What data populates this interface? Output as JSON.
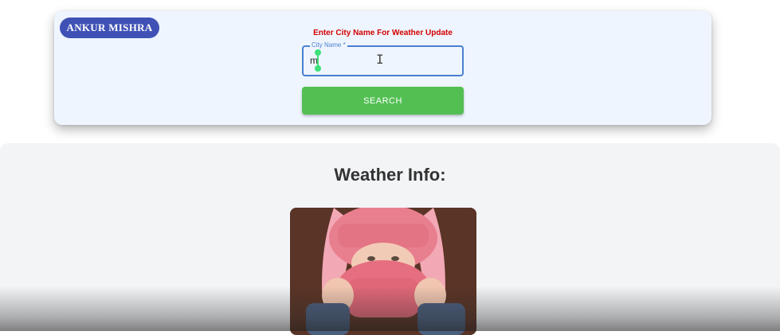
{
  "brand": {
    "name": "ANKUR MISHRA"
  },
  "search_form": {
    "prompt": "Enter City Name For Weather Update",
    "city_field_label": "City Name *",
    "city_field_value": "m",
    "search_button_label": "SEARCH"
  },
  "weather_section": {
    "title": "Weather Info:"
  },
  "colors": {
    "brand_badge": "#3f51b5",
    "prompt_text": "#d40000",
    "field_outline": "#4a7fd0",
    "search_button": "#53bf53",
    "card_background": "#eef5fe"
  },
  "icons": {
    "text_cursor": "i-beam-cursor-icon"
  }
}
